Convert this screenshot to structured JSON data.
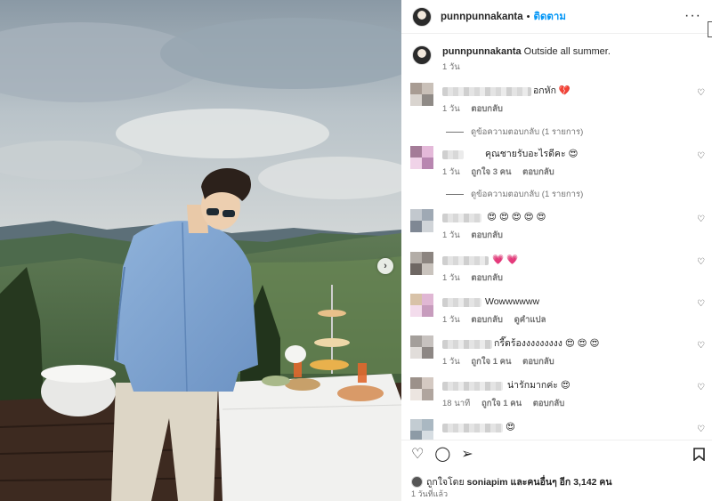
{
  "post": {
    "username": "punnpunnakanta",
    "follow_label": "ติดตาม",
    "caption": "Outside all summer.",
    "caption_time": "1 วัน"
  },
  "comments": [
    {
      "text": "อกหัก 💔",
      "time": "1 วัน",
      "likes": "",
      "reply": "ตอบกลับ",
      "translate": "",
      "view_replies": "ดูข้อความตอบกลับ (1 รายการ)"
    },
    {
      "text": "คุณชายรับอะไรดีคะ 😍",
      "time": "1 วัน",
      "likes": "ถูกใจ 3 คน",
      "reply": "ตอบกลับ",
      "translate": "",
      "view_replies": "ดูข้อความตอบกลับ (1 รายการ)"
    },
    {
      "text": "😍 😍 😍 😍 😍",
      "time": "1 วัน",
      "likes": "",
      "reply": "ตอบกลับ",
      "translate": "",
      "view_replies": ""
    },
    {
      "text": "💗 💗",
      "time": "1 วัน",
      "likes": "",
      "reply": "ตอบกลับ",
      "translate": "",
      "view_replies": ""
    },
    {
      "text": "Wowwwwww",
      "time": "1 วัน",
      "likes": "",
      "reply": "ตอบกลับ",
      "translate": "ดูคำแปล",
      "view_replies": ""
    },
    {
      "text": "กรี๊ดร้องงงงงงงงง 😍 😍 😍",
      "time": "1 วัน",
      "likes": "ถูกใจ 1 คน",
      "reply": "ตอบกลับ",
      "translate": "",
      "view_replies": ""
    },
    {
      "text": "น่ารักมากค่ะ 😍",
      "time": "18 นาที",
      "likes": "ถูกใจ 1 คน",
      "reply": "ตอบกลับ",
      "translate": "",
      "view_replies": ""
    },
    {
      "text": "😍",
      "time": "",
      "likes": "",
      "reply": "",
      "translate": "",
      "view_replies": ""
    }
  ],
  "footer": {
    "likes_prefix": "ถูกใจโดย",
    "liked_by_user": "soniapim",
    "likes_middle": "และคนอื่นๆ อีก",
    "likes_count": "3,142 คน",
    "time_ago": "1 วันที่แล้ว"
  },
  "icons": {
    "like": "heart-icon",
    "comment": "comment-icon",
    "share": "paper-plane-icon",
    "save": "bookmark-icon",
    "more": "more-icon",
    "next": "chevron-right-icon"
  },
  "colors": {
    "accent": "#0095f6",
    "text": "#262626",
    "muted": "#737373"
  }
}
